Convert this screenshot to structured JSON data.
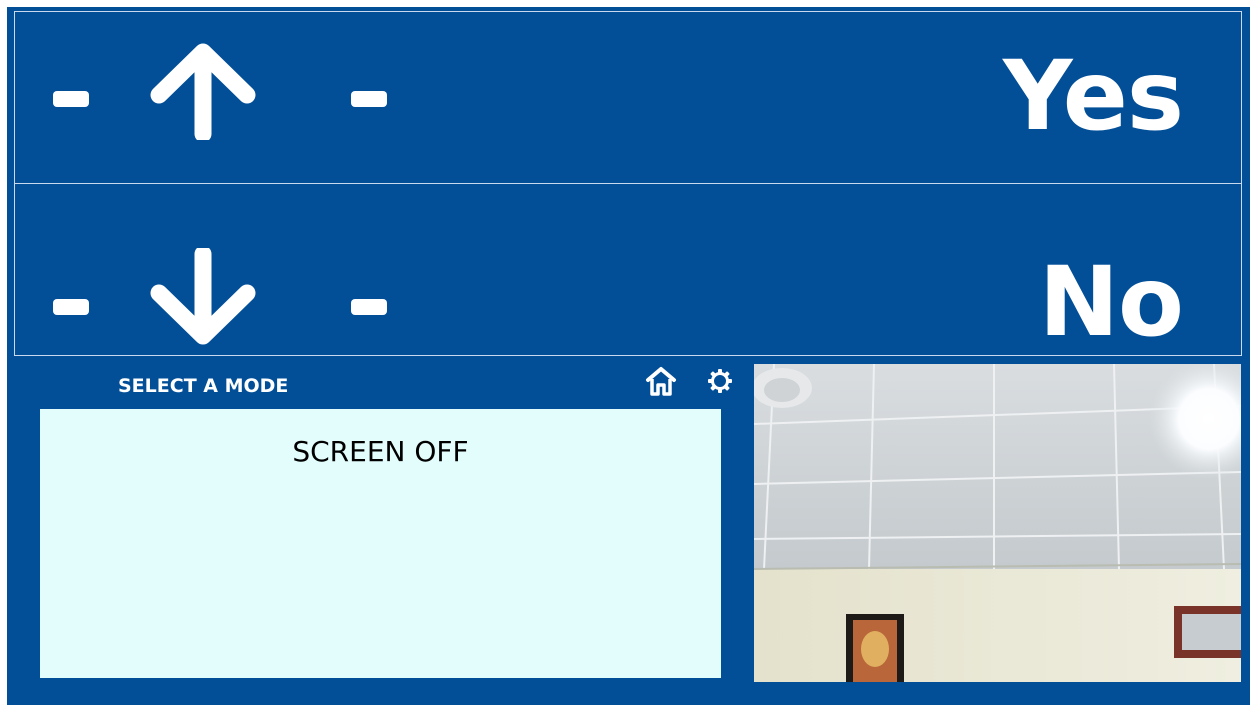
{
  "colors": {
    "background": "#024f98",
    "panel_border": "#c9d9ee",
    "mode_box": "#e3fcfc",
    "foreground": "#ffffff"
  },
  "yes_panel": {
    "icon": "arrow-up-icon",
    "answer": "Yes"
  },
  "no_panel": {
    "icon": "arrow-down-icon",
    "answer": "No"
  },
  "mode": {
    "label": "SELECT A MODE",
    "current": "SCREEN OFF",
    "home_icon": "home-icon",
    "settings_icon": "gear-icon"
  },
  "camera": {
    "icon": "camera-feed"
  }
}
